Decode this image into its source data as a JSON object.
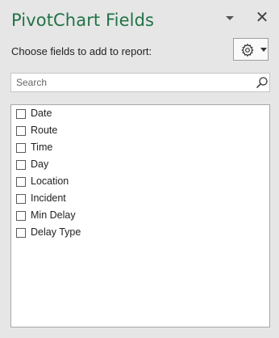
{
  "pane": {
    "title": "PivotChart Fields",
    "subtitle": "Choose fields to add to report:"
  },
  "search": {
    "placeholder": "Search"
  },
  "fields": [
    {
      "label": "Date",
      "checked": false
    },
    {
      "label": "Route",
      "checked": false
    },
    {
      "label": "Time",
      "checked": false
    },
    {
      "label": "Day",
      "checked": false
    },
    {
      "label": "Location",
      "checked": false
    },
    {
      "label": "Incident",
      "checked": false
    },
    {
      "label": "Min Delay",
      "checked": false
    },
    {
      "label": "Delay Type",
      "checked": false
    }
  ],
  "icons": {
    "pane_menu": "chevron-down-icon",
    "close": "close-icon",
    "tools": "gear-icon",
    "search": "search-icon"
  },
  "colors": {
    "title": "#217346",
    "pane_background": "#e6e6e6"
  }
}
